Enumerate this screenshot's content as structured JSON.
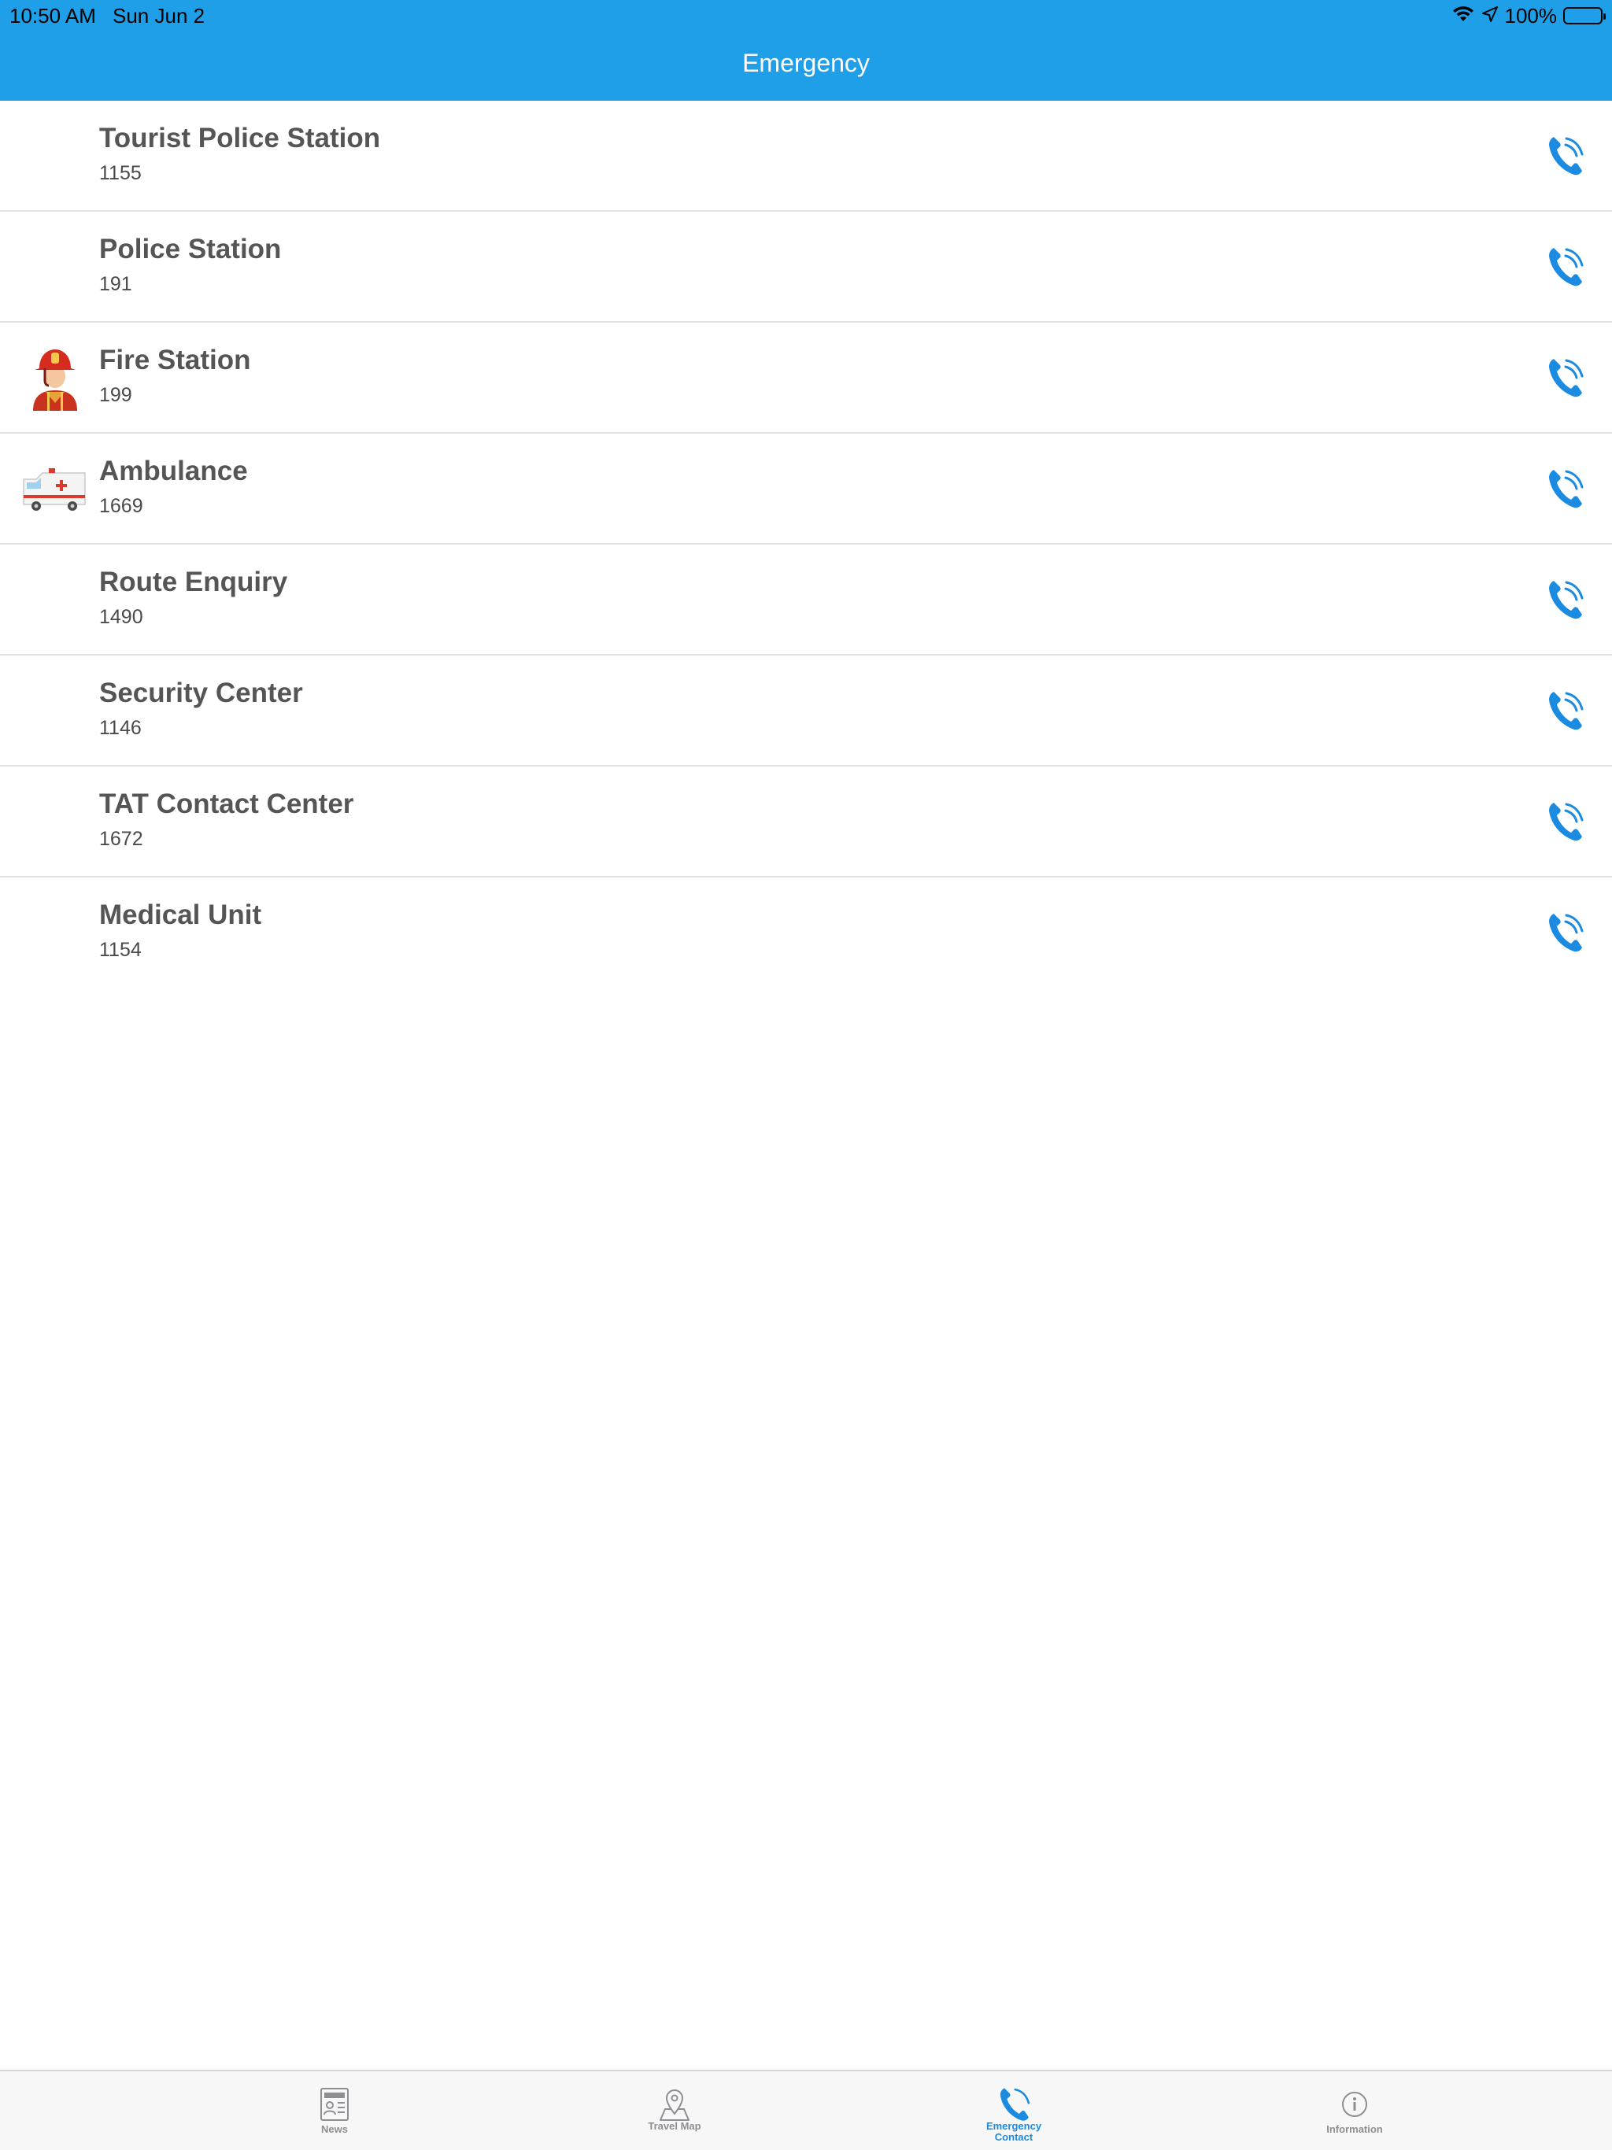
{
  "status_bar": {
    "time": "10:50 AM",
    "date": "Sun Jun 2",
    "battery": "100%"
  },
  "nav": {
    "title": "Emergency"
  },
  "colors": {
    "header": "#209fe9",
    "call_icon": "#1a8be0",
    "tab_active": "#1a8be0",
    "tab_inactive": "#8e8e93"
  },
  "contacts": [
    {
      "name": "Tourist Police Station",
      "number": "1155",
      "icon": "none"
    },
    {
      "name": "Police Station",
      "number": "191",
      "icon": "none"
    },
    {
      "name": "Fire Station",
      "number": "199",
      "icon": "firefighter-icon"
    },
    {
      "name": "Ambulance",
      "number": "1669",
      "icon": "ambulance-icon"
    },
    {
      "name": "Route Enquiry",
      "number": "1490",
      "icon": "none"
    },
    {
      "name": "Security Center",
      "number": "1146",
      "icon": "none"
    },
    {
      "name": "TAT Contact Center",
      "number": "1672",
      "icon": "none"
    },
    {
      "name": "Medical Unit",
      "number": "1154",
      "icon": "none"
    }
  ],
  "tabs": [
    {
      "label": "News",
      "icon": "news-icon",
      "active": false
    },
    {
      "label": "Travel Map",
      "icon": "map-pin-icon",
      "active": false
    },
    {
      "label": "Emergency Contact",
      "icon": "phone-icon",
      "active": true
    },
    {
      "label": "Information",
      "icon": "info-icon",
      "active": false
    }
  ]
}
